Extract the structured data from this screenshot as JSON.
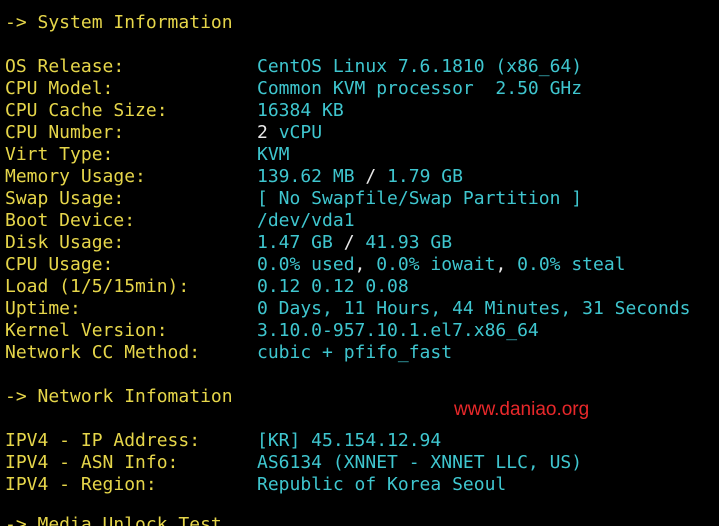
{
  "colors": {
    "background": "#000000",
    "heading": "#e6d64a",
    "label": "#e6d64a",
    "value": "#3fc6cf",
    "highlight": "#e8e8e8",
    "watermark": "#e8282a"
  },
  "section_system": {
    "title": "-> System Information",
    "rows": [
      {
        "label": "OS Release:",
        "value": "CentOS Linux 7.6.1810 (x86_64)"
      },
      {
        "label": "CPU Model:",
        "value": "Common KVM processor  2.50 GHz"
      },
      {
        "label": "CPU Cache Size:",
        "value": "16384 KB"
      },
      {
        "label": "CPU Number:",
        "count": "2",
        "value": "vCPU"
      },
      {
        "label": "Virt Type:",
        "value": "KVM"
      },
      {
        "label": "Memory Usage:",
        "used": "139.62 MB",
        "sep": "/",
        "total": "1.79 GB"
      },
      {
        "label": "Swap Usage:",
        "value": "[ No Swapfile/Swap Partition ]"
      },
      {
        "label": "Boot Device:",
        "value": "/dev/vda1"
      },
      {
        "label": "Disk Usage:",
        "used": "1.47 GB",
        "sep": "/",
        "total": "41.93 GB"
      },
      {
        "label": "CPU Usage:",
        "used": "0.0% used",
        "comma1": ",",
        "iowait": "0.0% iowait",
        "comma2": ",",
        "steal": "0.0% steal"
      },
      {
        "label": "Load (1/5/15min):",
        "value": "0.12 0.12 0.08"
      },
      {
        "label": "Uptime:",
        "value": "0 Days, 11 Hours, 44 Minutes, 31 Seconds"
      },
      {
        "label": "Kernel Version:",
        "value": "3.10.0-957.10.1.el7.x86_64"
      },
      {
        "label": "Network CC Method:",
        "value": "cubic + pfifo_fast"
      }
    ]
  },
  "section_network": {
    "title": "-> Network Infomation",
    "rows": [
      {
        "label": "IPV4 - IP Address:",
        "value": "[KR] 45.154.12.94"
      },
      {
        "label": "IPV4 - ASN Info:",
        "value": "AS6134 (XNNET - XNNET LLC, US)"
      },
      {
        "label": "IPV4 - Region:",
        "value": "Republic of Korea Seoul"
      }
    ]
  },
  "next_section_partial": "-> Media Unlock Test",
  "watermark": "www.daniao.org"
}
